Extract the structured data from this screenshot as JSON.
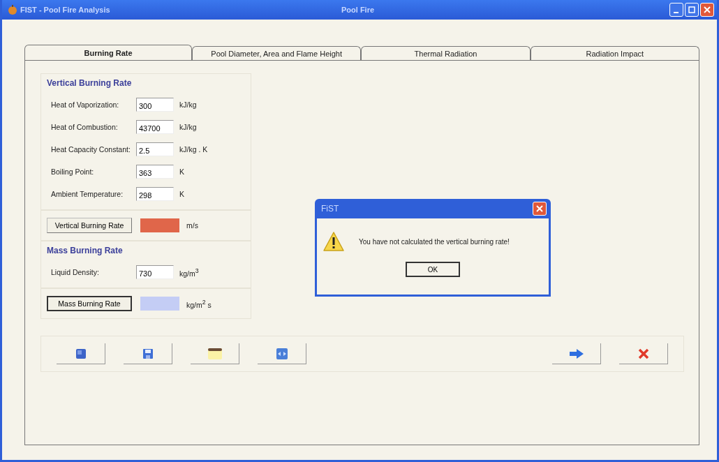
{
  "window": {
    "title": "FIST - Pool Fire Analysis",
    "subtitle": "Pool Fire"
  },
  "tabs": [
    {
      "label": "Burning Rate",
      "selected": true
    },
    {
      "label": "Pool Diameter, Area and Flame Height",
      "selected": false
    },
    {
      "label": "Thermal Radiation",
      "selected": false
    },
    {
      "label": "Radiation Impact",
      "selected": false
    }
  ],
  "vertical_burning_rate": {
    "title": "Vertical Burning Rate",
    "fields": [
      {
        "label": "Heat of Vaporization:",
        "value": "300",
        "unit": "kJ/kg"
      },
      {
        "label": "Heat of Combustion:",
        "value": "43700",
        "unit": "kJ/kg"
      },
      {
        "label": "Heat Capacity Constant:",
        "value": "2.5",
        "unit": "kJ/kg . K"
      },
      {
        "label": "Boiling Point:",
        "value": "363",
        "unit": "K"
      },
      {
        "label": "Ambient Temperature:",
        "value": "298",
        "unit": "K"
      }
    ],
    "result": {
      "button": "Vertical Burning Rate",
      "color": "#e0664a",
      "unit": "m/s",
      "focused": false
    }
  },
  "mass_burning_rate": {
    "title": "Mass Burning Rate",
    "fields": [
      {
        "label": "Liquid Density:",
        "value": "730",
        "unit": "kg/m$^{3}$"
      }
    ],
    "result": {
      "button": "Mass Burning Rate",
      "color": "#c4cdf5",
      "unit": "kg/m$^{2}$ s",
      "focused": true
    }
  },
  "toolbar": [
    {
      "kind": "open"
    },
    {
      "kind": "save"
    },
    {
      "kind": "note"
    },
    {
      "kind": "fit"
    },
    {
      "kind": "next"
    },
    {
      "kind": "close"
    }
  ],
  "dialog": {
    "title": "FiST",
    "message": "You have not calculated the vertical burning rate!",
    "button": "OK"
  }
}
